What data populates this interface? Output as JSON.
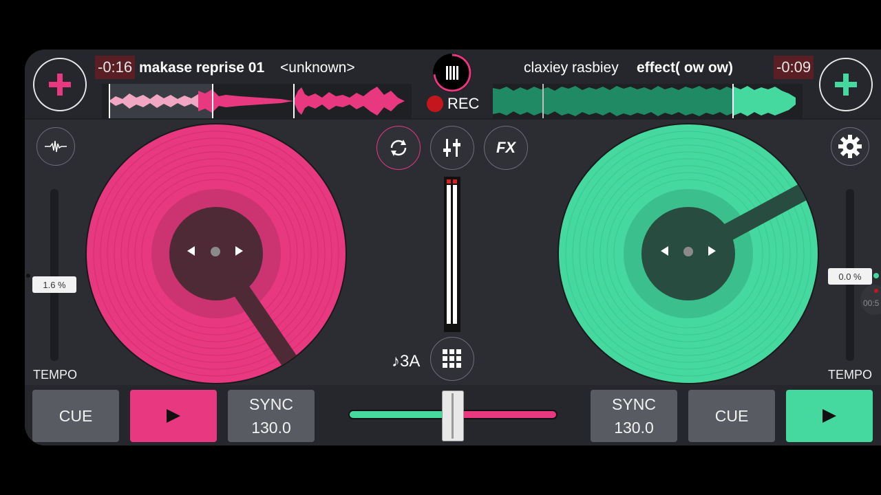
{
  "deck_a": {
    "time_remaining": "-0:16",
    "title": "makase reprise 01",
    "artist": "<unknown>",
    "tempo_value": "1.6 %",
    "tempo_label": "TEMPO",
    "cue_label": "CUE",
    "sync_label": "SYNC",
    "bpm": "130.0",
    "color": "#e8387f",
    "add_icon": "plus-icon",
    "left_tool_icon": "waveform-icon"
  },
  "deck_b": {
    "time_remaining": "-0:09",
    "title": "effect( ow ow)",
    "artist": "claxiey rasbiey",
    "tempo_value": "0.0 %",
    "tempo_label": "TEMPO",
    "cue_label": "CUE",
    "sync_label": "SYNC",
    "bpm": "130.0",
    "color": "#45d9a0",
    "add_icon": "plus-icon",
    "right_tool_icon": "gear-icon",
    "overlay_time": "00:5"
  },
  "center": {
    "rec_label": "REC",
    "fx_label": "FX",
    "key_label": "♪3A",
    "icons": [
      "menu-icon",
      "sync-loop-icon",
      "mixer-icon",
      "grid-icon"
    ]
  },
  "crossfader": {
    "position": 0.5
  }
}
